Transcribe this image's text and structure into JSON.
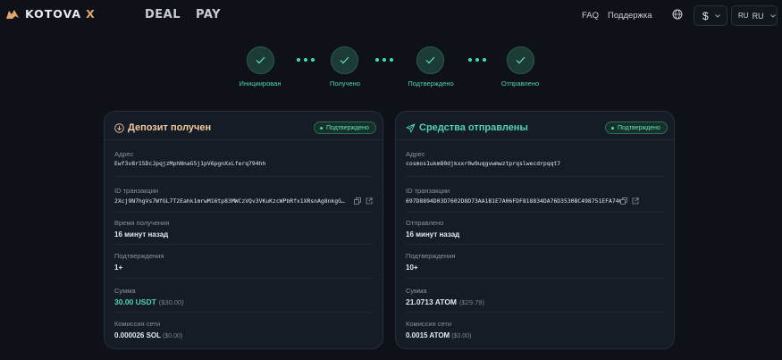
{
  "header": {
    "brand": "KOTOVA",
    "brand_x": "X",
    "nav": [
      "DEAL",
      "PAY"
    ],
    "faq": "FAQ",
    "support": "Поддержка",
    "currency_symbol": "$",
    "lang_small": "RU",
    "lang": "RU"
  },
  "steps": [
    "Инициирован",
    "Получено",
    "Подтверждено",
    "Отправлено"
  ],
  "deposit": {
    "title": "Депозит получен",
    "status": "Подтверждено",
    "address_label": "Адрес",
    "address": "Ewf3v8r15DcJpqjzMphNnaG5j1pV6pgnXxLferq794hh",
    "txid_label": "ID транзакции",
    "txid": "2Xcj9N7hgVs7WfGL7T2Eahk1mrwM16tp83MWCzVQv3VKuKzcWPbRfx1XRsnAg8nkgG6K8mW2bzr4",
    "time_label": "Время получения",
    "time": "16 минут назад",
    "conf_label": "Подтверждения",
    "conf": "1+",
    "amount_label": "Сумма",
    "amount": "30.00 USDT",
    "amount_usd": "($30.00)",
    "fee_label": "Комиссия сети",
    "fee": "0.000026 SOL",
    "fee_usd": "($0.00)"
  },
  "sent": {
    "title": "Средства отправлены",
    "status": "Подтверждено",
    "address_label": "Адрес",
    "address": "cosmos1ukm80djkxxr0w9uqgvwmwztprqslwecdrpqqt7",
    "txid_label": "ID транзакции",
    "txid": "697D8894D03D7602D8D73AA1B1E7A06FDF818834DA76D3530BC498751EFA746",
    "time_label": "Отправлено",
    "time": "16 минут назад",
    "conf_label": "Подтверждения",
    "conf": "10+",
    "amount_label": "Сумма",
    "amount": "21.0713 ATOM",
    "amount_usd": "($29.79)",
    "fee_label": "Комиссия сети",
    "fee": "0.0015 ATOM",
    "fee_usd": "($0.00)"
  },
  "colors": {
    "accent": "#4fd3b3",
    "deposit_title": "#f0c9a0",
    "background": "#0e1218",
    "card": "#151c25"
  }
}
